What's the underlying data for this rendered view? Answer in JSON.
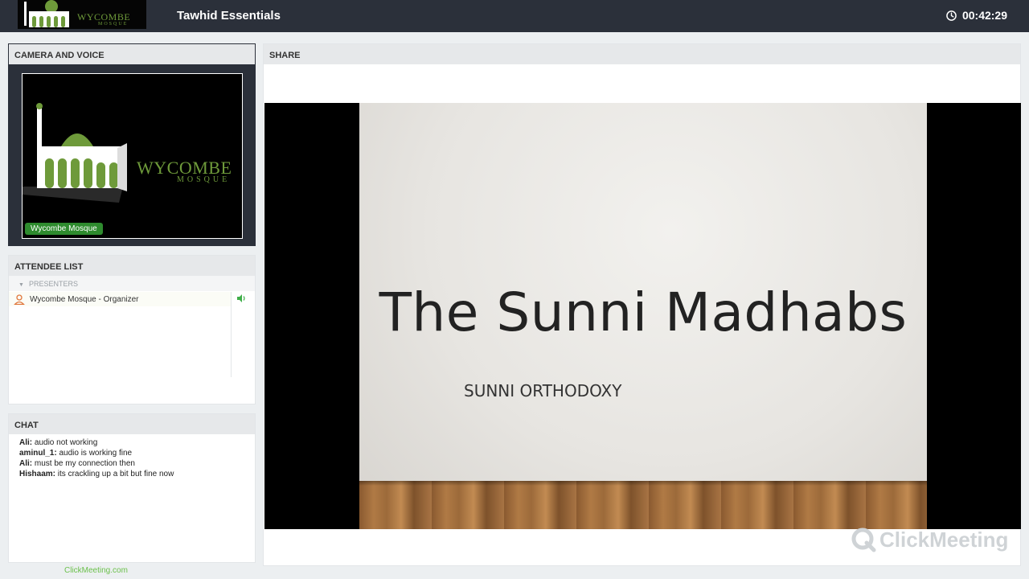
{
  "header": {
    "logo_text": "WYCOMBE",
    "logo_sub": "MOSQUE",
    "title": "Tawhid Essentials",
    "timer": "00:42:29",
    "timer_icon": "clock-icon"
  },
  "camera": {
    "header": "CAMERA AND VOICE",
    "logo_text": "WYCOMBE",
    "logo_sub": "MOSQUE",
    "name_badge": "Wycombe Mosque"
  },
  "attendees": {
    "header": "ATTENDEE LIST",
    "group_label": "PRESENTERS",
    "items": [
      {
        "name": "Wycombe Mosque - Organizer",
        "icon": "user-icon",
        "status_icon": "speaker-icon"
      }
    ]
  },
  "chat": {
    "header": "CHAT",
    "messages": [
      {
        "author": "Ali:",
        "text": "audio not working"
      },
      {
        "author": "aminul_1:",
        "text": "audio is working fine"
      },
      {
        "author": "Ali:",
        "text": "must be my connection then"
      },
      {
        "author": "Hishaam:",
        "text": "its crackling up a bit but fine now"
      }
    ]
  },
  "share": {
    "header": "SHARE",
    "slide_title": "The Sunni Madhabs",
    "slide_subtitle": "SUNNI ORTHODOXY",
    "watermark": "ClickMeeting"
  },
  "footer": {
    "link": "ClickMeeting.com"
  },
  "colors": {
    "topbar": "#2b303a",
    "brand_green": "#6e9a3a",
    "badge_green": "#2e8b2e",
    "link_green": "#6bc04b"
  }
}
